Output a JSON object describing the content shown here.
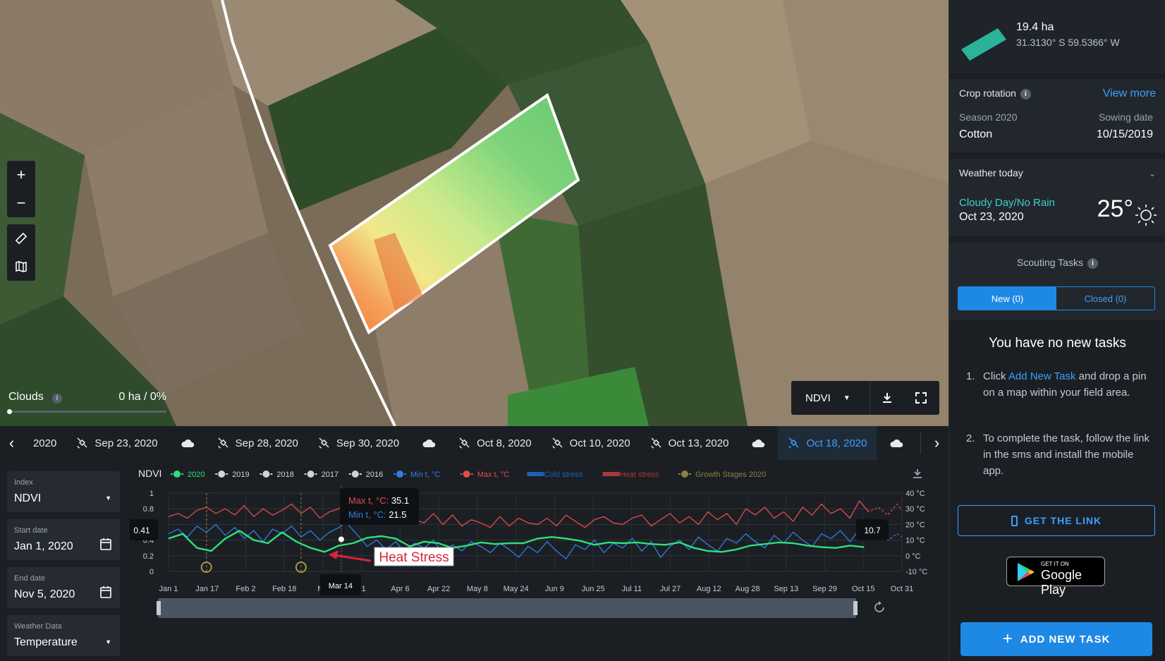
{
  "map": {
    "zoom_in": "+",
    "zoom_out": "−",
    "clouds_label": "Clouds",
    "clouds_value": "0 ha / 0%",
    "layer": "NDVI"
  },
  "date_strip": {
    "items": [
      {
        "label": "2020",
        "type": "text"
      },
      {
        "label": "Sep 23, 2020",
        "type": "sat"
      },
      {
        "label": "",
        "type": "cloud"
      },
      {
        "label": "Sep 28, 2020",
        "type": "sat"
      },
      {
        "label": "Sep 30, 2020",
        "type": "sat"
      },
      {
        "label": "",
        "type": "cloud"
      },
      {
        "label": "Oct 8, 2020",
        "type": "sat"
      },
      {
        "label": "Oct 10, 2020",
        "type": "sat"
      },
      {
        "label": "Oct 13, 2020",
        "type": "sat"
      },
      {
        "label": "",
        "type": "cloud"
      },
      {
        "label": "Oct 18, 2020",
        "type": "sat",
        "active": true
      },
      {
        "label": "",
        "type": "cloud"
      }
    ]
  },
  "form": {
    "index_label": "Index",
    "index_value": "NDVI",
    "start_label": "Start date",
    "start_value": "Jan 1, 2020",
    "end_label": "End date",
    "end_value": "Nov 5, 2020",
    "weather_label": "Weather Data",
    "weather_value": "Temperature"
  },
  "chart_data": {
    "type": "line",
    "title": "NDVI",
    "legend": [
      {
        "name": "2020",
        "color": "#2ee07a",
        "kind": "dot"
      },
      {
        "name": "2019",
        "color": "#cfd4d9",
        "kind": "dot"
      },
      {
        "name": "2018",
        "color": "#cfd4d9",
        "kind": "dot"
      },
      {
        "name": "2017",
        "color": "#cfd4d9",
        "kind": "dot"
      },
      {
        "name": "2016",
        "color": "#cfd4d9",
        "kind": "dot"
      },
      {
        "name": "Min t, °C",
        "color": "#2f7fe0",
        "kind": "dot"
      },
      {
        "name": "Max t, °C",
        "color": "#e24b4b",
        "kind": "dot"
      },
      {
        "name": "Cold stress",
        "color": "#1e5fb8",
        "kind": "bar"
      },
      {
        "name": "Heat stress",
        "color": "#a83a3a",
        "kind": "bar"
      },
      {
        "name": "Growth Stages 2020",
        "color": "#8d8240",
        "kind": "dot"
      }
    ],
    "y_left_ticks": [
      "1",
      "0.8",
      "0.6",
      "0.4",
      "0.2",
      "0"
    ],
    "y_left_range": [
      0,
      1
    ],
    "y_right_ticks": [
      "40 °C",
      "30 °C",
      "20 °C",
      "10 °C",
      "0 °C",
      "-10 °C"
    ],
    "y_right_range": [
      -10,
      40
    ],
    "x_ticks": [
      "Jan 1",
      "Jan 17",
      "Feb 2",
      "Feb 18",
      "Ma",
      "21",
      "Apr 6",
      "Apr 22",
      "May 8",
      "May 24",
      "Jun 9",
      "Jun 25",
      "Jul 11",
      "Jul 27",
      "Aug 12",
      "Aug 28",
      "Sep 13",
      "Sep 29",
      "Oct 15",
      "Oct 31"
    ],
    "x_range_days": [
      0,
      310
    ],
    "ndvi_2020": [
      [
        0,
        0.42
      ],
      [
        6,
        0.48
      ],
      [
        12,
        0.3
      ],
      [
        18,
        0.26
      ],
      [
        24,
        0.42
      ],
      [
        30,
        0.52
      ],
      [
        36,
        0.4
      ],
      [
        42,
        0.36
      ],
      [
        48,
        0.5
      ],
      [
        54,
        0.38
      ],
      [
        60,
        0.3
      ],
      [
        66,
        0.25
      ],
      [
        72,
        0.33
      ],
      [
        78,
        0.36
      ],
      [
        84,
        0.43
      ],
      [
        90,
        0.45
      ],
      [
        96,
        0.42
      ],
      [
        102,
        0.32
      ],
      [
        108,
        0.38
      ],
      [
        114,
        0.36
      ],
      [
        120,
        0.3
      ],
      [
        126,
        0.33
      ],
      [
        132,
        0.37
      ],
      [
        138,
        0.35
      ],
      [
        144,
        0.36
      ],
      [
        150,
        0.36
      ],
      [
        156,
        0.42
      ],
      [
        162,
        0.44
      ],
      [
        168,
        0.42
      ],
      [
        174,
        0.39
      ],
      [
        180,
        0.34
      ],
      [
        186,
        0.37
      ],
      [
        192,
        0.36
      ],
      [
        198,
        0.37
      ],
      [
        204,
        0.35
      ],
      [
        210,
        0.34
      ],
      [
        216,
        0.37
      ],
      [
        222,
        0.3
      ],
      [
        228,
        0.26
      ],
      [
        234,
        0.25
      ],
      [
        240,
        0.28
      ],
      [
        246,
        0.33
      ],
      [
        252,
        0.35
      ],
      [
        258,
        0.37
      ],
      [
        264,
        0.36
      ],
      [
        270,
        0.33
      ],
      [
        276,
        0.31
      ],
      [
        282,
        0.3
      ],
      [
        288,
        0.33
      ],
      [
        294,
        0.31
      ],
      [
        300,
        0.28
      ],
      [
        306,
        0.27
      ],
      [
        310,
        0.3
      ]
    ],
    "max_temp": [
      [
        0,
        25
      ],
      [
        4,
        27
      ],
      [
        8,
        24
      ],
      [
        12,
        29
      ],
      [
        16,
        31
      ],
      [
        20,
        27
      ],
      [
        24,
        30
      ],
      [
        28,
        26
      ],
      [
        32,
        32
      ],
      [
        36,
        25
      ],
      [
        40,
        30
      ],
      [
        44,
        26
      ],
      [
        48,
        29
      ],
      [
        52,
        33
      ],
      [
        56,
        27
      ],
      [
        60,
        31
      ],
      [
        64,
        24
      ],
      [
        68,
        28
      ],
      [
        72,
        30
      ],
      [
        75,
        35.1
      ],
      [
        80,
        26
      ],
      [
        84,
        24
      ],
      [
        88,
        25
      ],
      [
        92,
        22
      ],
      [
        96,
        20
      ],
      [
        100,
        24
      ],
      [
        104,
        23
      ],
      [
        108,
        21
      ],
      [
        112,
        27
      ],
      [
        116,
        20
      ],
      [
        120,
        26
      ],
      [
        124,
        19
      ],
      [
        128,
        23
      ],
      [
        132,
        21
      ],
      [
        136,
        18
      ],
      [
        140,
        25
      ],
      [
        144,
        19
      ],
      [
        148,
        24
      ],
      [
        152,
        21
      ],
      [
        156,
        20
      ],
      [
        160,
        24
      ],
      [
        164,
        19
      ],
      [
        168,
        26
      ],
      [
        172,
        22
      ],
      [
        176,
        18
      ],
      [
        180,
        23
      ],
      [
        184,
        25
      ],
      [
        188,
        21
      ],
      [
        192,
        20
      ],
      [
        196,
        24
      ],
      [
        200,
        26
      ],
      [
        204,
        19
      ],
      [
        208,
        23
      ],
      [
        212,
        27
      ],
      [
        216,
        21
      ],
      [
        220,
        25
      ],
      [
        224,
        20
      ],
      [
        228,
        28
      ],
      [
        232,
        23
      ],
      [
        236,
        27
      ],
      [
        240,
        20
      ],
      [
        244,
        30
      ],
      [
        248,
        26
      ],
      [
        252,
        31
      ],
      [
        256,
        24
      ],
      [
        260,
        28
      ],
      [
        264,
        22
      ],
      [
        268,
        31
      ],
      [
        272,
        26
      ],
      [
        276,
        33
      ],
      [
        280,
        27
      ],
      [
        284,
        30
      ],
      [
        288,
        24
      ],
      [
        292,
        35
      ],
      [
        296,
        28
      ],
      [
        300,
        31
      ],
      [
        304,
        26
      ],
      [
        308,
        33
      ],
      [
        310,
        29
      ]
    ],
    "min_temp": [
      [
        0,
        14
      ],
      [
        4,
        17
      ],
      [
        8,
        12
      ],
      [
        12,
        19
      ],
      [
        16,
        15
      ],
      [
        20,
        20
      ],
      [
        24,
        13
      ],
      [
        28,
        18
      ],
      [
        32,
        11
      ],
      [
        36,
        16
      ],
      [
        40,
        9
      ],
      [
        44,
        17
      ],
      [
        48,
        14
      ],
      [
        52,
        19
      ],
      [
        56,
        12
      ],
      [
        60,
        16
      ],
      [
        64,
        10
      ],
      [
        68,
        15
      ],
      [
        72,
        18
      ],
      [
        75,
        21.5
      ],
      [
        80,
        13
      ],
      [
        84,
        6
      ],
      [
        88,
        10
      ],
      [
        92,
        4
      ],
      [
        96,
        9
      ],
      [
        100,
        2
      ],
      [
        104,
        8
      ],
      [
        108,
        5
      ],
      [
        112,
        10
      ],
      [
        116,
        1
      ],
      [
        120,
        7
      ],
      [
        124,
        3
      ],
      [
        128,
        9
      ],
      [
        132,
        6
      ],
      [
        136,
        2
      ],
      [
        140,
        8
      ],
      [
        144,
        4
      ],
      [
        148,
        -1
      ],
      [
        152,
        6
      ],
      [
        156,
        2
      ],
      [
        160,
        9
      ],
      [
        164,
        3
      ],
      [
        168,
        -2
      ],
      [
        172,
        7
      ],
      [
        176,
        4
      ],
      [
        180,
        10
      ],
      [
        184,
        2
      ],
      [
        188,
        8
      ],
      [
        192,
        5
      ],
      [
        196,
        11
      ],
      [
        200,
        3
      ],
      [
        204,
        9
      ],
      [
        208,
        -1
      ],
      [
        212,
        6
      ],
      [
        216,
        10
      ],
      [
        220,
        4
      ],
      [
        224,
        12
      ],
      [
        228,
        7
      ],
      [
        232,
        3
      ],
      [
        236,
        11
      ],
      [
        240,
        8
      ],
      [
        244,
        14
      ],
      [
        248,
        9
      ],
      [
        252,
        5
      ],
      [
        256,
        13
      ],
      [
        260,
        8
      ],
      [
        264,
        15
      ],
      [
        268,
        10
      ],
      [
        272,
        6
      ],
      [
        276,
        14
      ],
      [
        280,
        11
      ],
      [
        284,
        16
      ],
      [
        288,
        9
      ],
      [
        292,
        17
      ],
      [
        296,
        12
      ],
      [
        300,
        15
      ],
      [
        304,
        10
      ],
      [
        308,
        14
      ],
      [
        310,
        12
      ]
    ],
    "growth_stages_days": [
      16,
      56
    ],
    "heat_stress_day": 73,
    "tooltip": {
      "max_label": "Max t, °C:",
      "max_value": "35.1",
      "min_label": "Min t, °C:",
      "min_value": "21.5"
    },
    "cursor_x_label": "Mar 14",
    "left_readout": "0.41",
    "right_readout": "10.7",
    "annotation": "Heat Stress"
  },
  "sidebar": {
    "field_area": "19.4 ha",
    "field_coords": "31.3130° S 59.5366° W",
    "crop_rotation_title": "Crop rotation",
    "view_more": "View more",
    "season_label": "Season 2020",
    "sowing_label": "Sowing date",
    "crop": "Cotton",
    "sowing_date": "10/15/2019",
    "weather_title": "Weather today",
    "weather_condition": "Cloudy Day/No Rain",
    "weather_date": "Oct 23, 2020",
    "weather_temp": "25°",
    "scouting_title": "Scouting Tasks",
    "tab_new": "New (0)",
    "tab_closed": "Closed (0)",
    "no_tasks": "You have no new tasks",
    "step1_pre": "Click ",
    "step1_link": "Add New Task",
    "step1_post": " and drop a pin on a map within your field area.",
    "step2": "To complete the task, follow the link in the sms and install the mobile app.",
    "get_link": "GET THE LINK",
    "gplay_small": "GET IT ON",
    "gplay_big": "Google Play",
    "add_task": "ADD NEW TASK"
  },
  "colors": {
    "accent": "#1e88e5",
    "link": "#3aa0ff",
    "ndvi_line": "#2ee07a",
    "max_temp": "#e24b4b",
    "min_temp": "#2f7fe0"
  }
}
